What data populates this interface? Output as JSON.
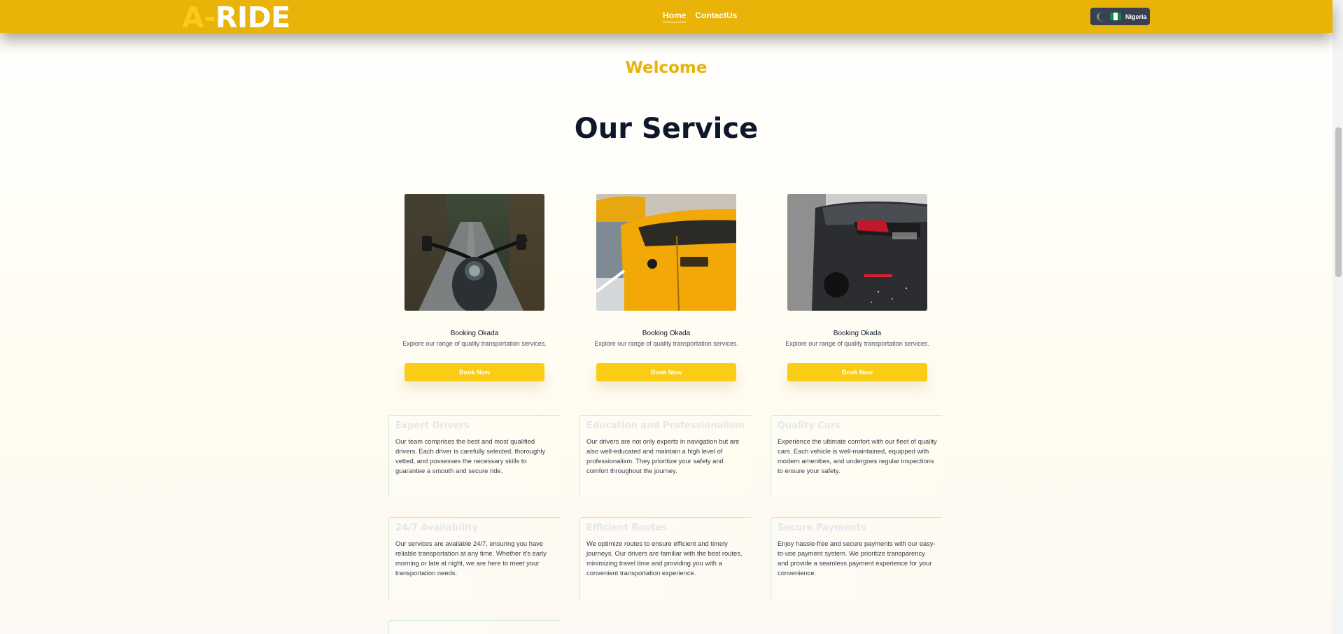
{
  "header": {
    "logo_part1": "A-",
    "logo_part2": "RIDE",
    "nav": [
      "Home",
      "ContactUs"
    ],
    "locale": "Nigeria",
    "colors": {
      "primary": "#eab308",
      "accent": "#facc15",
      "dark": "#374151"
    }
  },
  "hero": {
    "welcome": "Welcome",
    "title": "Our Service"
  },
  "services": [
    {
      "title": "Booking Okada",
      "desc": "Explore our range of quality transportation services.",
      "button": "Book Now",
      "image": "motorcycle-road-photo"
    },
    {
      "title": "Booking Okada",
      "desc": "Explore our range of quality transportation services.",
      "button": "Book Now",
      "image": "yellow-taxi-photo"
    },
    {
      "title": "Booking Okada",
      "desc": "Explore our range of quality transportation services.",
      "button": "Book Now",
      "image": "dark-car-photo"
    }
  ],
  "features": [
    {
      "title": "Expert Drivers",
      "text": "Our team comprises the best and most qualified drivers. Each driver is carefully selected, thoroughly vetted, and possesses the necessary skills to guarantee a smooth and secure ride."
    },
    {
      "title": "Education and Professionalism",
      "text": "Our drivers are not only experts in navigation but are also well-educated and maintain a high level of professionalism. They prioritize your safety and comfort throughout the journey."
    },
    {
      "title": "Quality Cars",
      "text": "Experience the ultimate comfort with our fleet of quality cars. Each vehicle is well-maintained, equipped with modern amenities, and undergoes regular inspections to ensure your safety."
    },
    {
      "title": "24/7 Availability",
      "text": "Our services are available 24/7, ensuring you have reliable transportation at any time. Whether it's early morning or late at night, we are here to meet your transportation needs."
    },
    {
      "title": "Efficient Routes",
      "text": "We optimize routes to ensure efficient and timely journeys. Our drivers are familiar with the best routes, minimizing travel time and providing you with a convenient transportation experience."
    },
    {
      "title": "Secure Payments",
      "text": "Enjoy hassle-free and secure payments with our easy-to-use payment system. We prioritize transparency and provide a seamless payment experience for your convenience."
    }
  ]
}
